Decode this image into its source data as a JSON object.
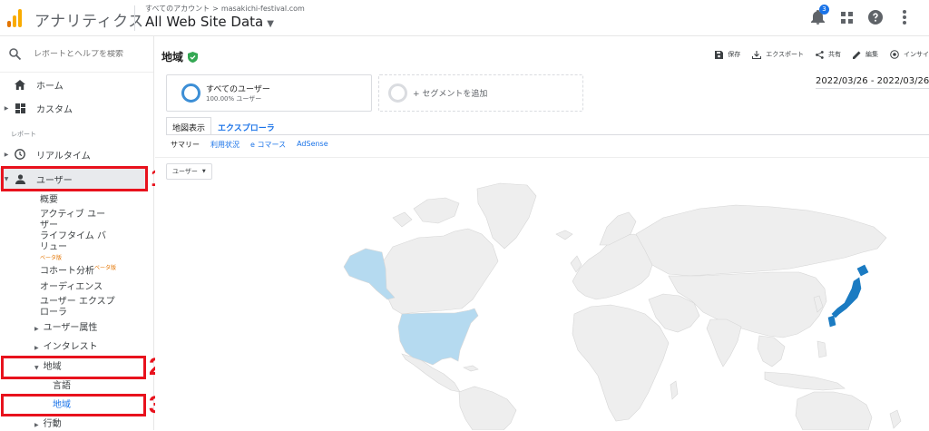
{
  "topbar": {
    "app_name": "アナリティクス",
    "breadcrumb": [
      "すべてのアカウント",
      "masakichi-festival.com"
    ],
    "breadcrumb_sep": ">",
    "view_name": "All Web Site Data",
    "notification_count": "3"
  },
  "sidebar": {
    "search_placeholder": "レポートとヘルプを検索",
    "home": "ホーム",
    "custom": "カスタム",
    "reports_label": "レポート",
    "realtime": "リアルタイム",
    "users": "ユーザー",
    "overview": "概要",
    "active_users": [
      "アクティブ ユー",
      "ザー"
    ],
    "lifetime_value": [
      "ライフタイム バ",
      "リュー"
    ],
    "beta_label": "ベータ版",
    "cohort": "コホート分析",
    "audiences": "オーディエンス",
    "user_explorer": [
      "ユーザー エクスプ",
      "ローラ"
    ],
    "demographics": "ユーザー属性",
    "interests": "インタレスト",
    "geo": "地域",
    "language": "言語",
    "location": "地域",
    "behavior": "行動"
  },
  "annotations": [
    "1",
    "2",
    "3"
  ],
  "main": {
    "title": "地域",
    "actions": [
      "保存",
      "エクスポート",
      "共有",
      "編集",
      "インサイ"
    ],
    "segment": {
      "title": "すべてのユーザー",
      "subtitle": "100.00% ユーザー"
    },
    "add_segment": "+ セグメントを追加",
    "date_range": "2022/03/26 - 2022/03/26",
    "tabs": [
      "地図表示",
      "エクスプローラ"
    ],
    "subtabs": [
      "サマリー",
      "利用状況",
      "e コマース",
      "AdSense"
    ],
    "dimension_dropdown": "ユーザー"
  },
  "map_colors": {
    "land": "#eeeeee",
    "border": "#d6d6d6",
    "low": "#b5daf0",
    "high": "#1b7bc2"
  }
}
